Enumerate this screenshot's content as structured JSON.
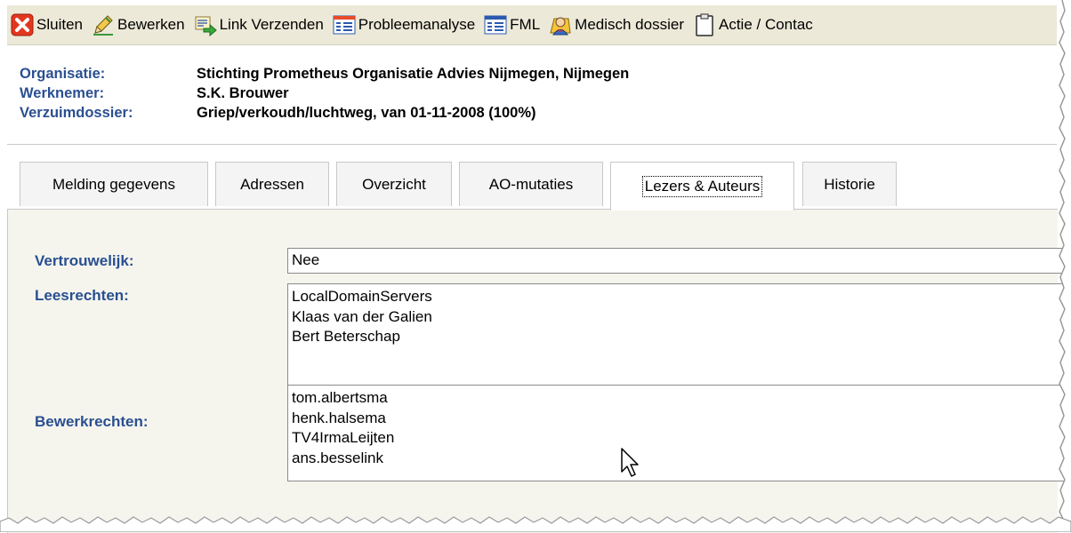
{
  "toolbar": {
    "buttons": [
      {
        "label": "Sluiten",
        "icon": "close-icon"
      },
      {
        "label": "Bewerken",
        "icon": "pencil-icon"
      },
      {
        "label": "Link Verzenden",
        "icon": "send-link-icon"
      },
      {
        "label": "Probleemanalyse",
        "icon": "form-icon"
      },
      {
        "label": "FML",
        "icon": "form-icon"
      },
      {
        "label": "Medisch dossier",
        "icon": "doctor-icon"
      },
      {
        "label": "Actie / Contac",
        "icon": "clipboard-icon"
      }
    ]
  },
  "header": {
    "organisatie_label": "Organisatie:",
    "organisatie_value": "Stichting Prometheus Organisatie Advies Nijmegen, Nijmegen",
    "werknemer_label": "Werknemer:",
    "werknemer_value": "S.K. Brouwer",
    "verzuim_label": "Verzuimdossier:",
    "verzuim_value": "Griep/verkoudh/luchtweg, van 01-11-2008 (100%)"
  },
  "tabs": [
    {
      "label": "Melding gegevens",
      "active": false
    },
    {
      "label": "Adressen",
      "active": false
    },
    {
      "label": "Overzicht",
      "active": false
    },
    {
      "label": "AO-mutaties",
      "active": false
    },
    {
      "label": "Lezers & Auteurs",
      "active": true
    },
    {
      "label": "Historie",
      "active": false
    }
  ],
  "form": {
    "vertrouwelijk_label": "Vertrouwelijk:",
    "vertrouwelijk_value": "Nee",
    "leesrechten_label": "Leesrechten:",
    "leesrechten": [
      "LocalDomainServers",
      "Klaas van der Galien",
      "Bert Beterschap"
    ],
    "bewerkrechten_label": "Bewerkrechten:",
    "bewerkrechten": [
      "tom.albertsma",
      "henk.halsema",
      "TV4IrmaLeijten",
      "ans.besselink"
    ]
  },
  "colors": {
    "label_blue": "#2a4f91",
    "toolbar_bg": "#ece9d8",
    "panel_bg": "#f5f5ee"
  }
}
